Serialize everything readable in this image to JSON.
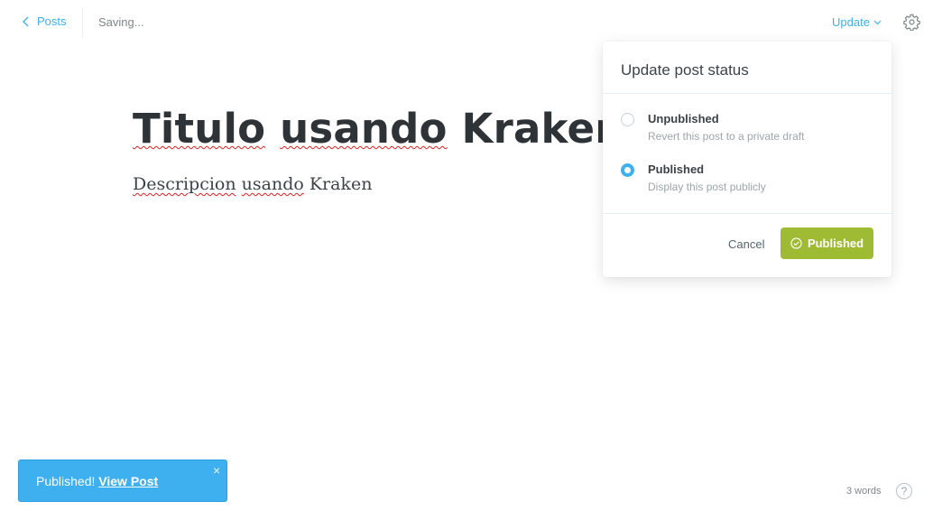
{
  "header": {
    "back_label": "Posts",
    "status_text": "Saving...",
    "update_label": "Update"
  },
  "editor": {
    "title_words": [
      "Titulo",
      "usando",
      "Kraken"
    ],
    "body_words": [
      "Descripcion",
      "usando",
      "Kraken"
    ]
  },
  "popover": {
    "title": "Update post status",
    "options": [
      {
        "label": "Unpublished",
        "description": "Revert this post to a private draft",
        "selected": false
      },
      {
        "label": "Published",
        "description": "Display this post publicly",
        "selected": true
      }
    ],
    "cancel_label": "Cancel",
    "confirm_label": "Published"
  },
  "toast": {
    "message": "Published!",
    "link_label": "View Post",
    "close_glyph": "×"
  },
  "footer": {
    "word_count": "3 words",
    "help_glyph": "?"
  },
  "colors": {
    "accent": "#3eb0ef",
    "publish_green": "#9fbb34",
    "spellcheck_red": "#e02020"
  }
}
